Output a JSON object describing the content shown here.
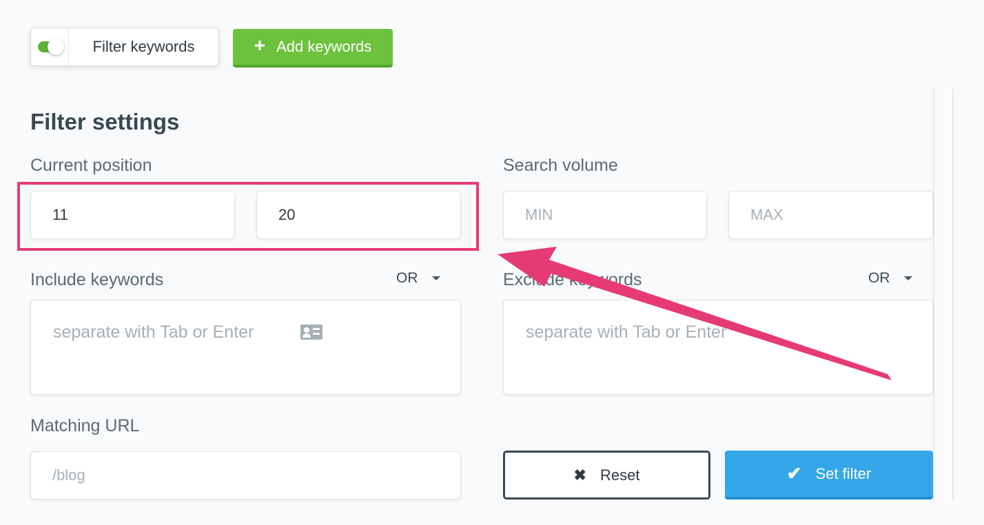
{
  "toolbar": {
    "filter_toggle_label": "Filter keywords",
    "filter_toggle_state": "on",
    "add_keywords_label": "Add keywords",
    "add_keywords_icon": "plus-icon"
  },
  "panel": {
    "title": "Filter settings",
    "current_position": {
      "label": "Current position",
      "from_value": "11",
      "to_value": "20"
    },
    "search_volume": {
      "label": "Search volume",
      "min_placeholder": "MIN",
      "max_placeholder": "MAX"
    },
    "include_keywords": {
      "label": "Include keywords",
      "operator": "OR",
      "placeholder": "separate with Tab or Enter",
      "icon": "contact-card-icon"
    },
    "exclude_keywords": {
      "label": "Exclude keywords",
      "operator": "OR",
      "placeholder": "separate with Tab or Enter"
    },
    "matching_url": {
      "label": "Matching URL",
      "placeholder": "/blog"
    },
    "reset_label": "Reset",
    "set_filter_label": "Set filter"
  },
  "colors": {
    "accent_green": "#6cc13d",
    "accent_blue": "#34a7e8",
    "annotation_pink": "#e63a73",
    "title_text": "#394850"
  }
}
